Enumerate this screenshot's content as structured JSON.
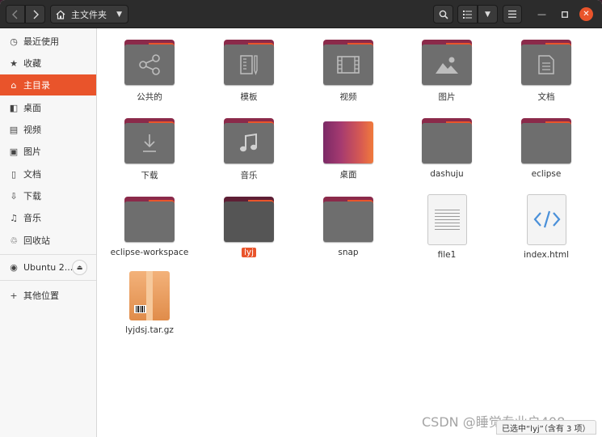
{
  "header": {
    "path_label": "主文件夹",
    "icons": {
      "back": "chevron-left-icon",
      "forward": "chevron-right-icon",
      "home": "home-icon",
      "search": "search-icon",
      "list": "list-view-icon",
      "menu": "hamburger-menu-icon"
    }
  },
  "sidebar": {
    "items": [
      {
        "label": "最近使用",
        "icon": "clock-icon"
      },
      {
        "label": "收藏",
        "icon": "star-icon"
      },
      {
        "label": "主目录",
        "icon": "home-icon",
        "active": true
      },
      {
        "label": "桌面",
        "icon": "desktop-icon"
      },
      {
        "label": "视频",
        "icon": "video-icon"
      },
      {
        "label": "图片",
        "icon": "image-icon"
      },
      {
        "label": "文档",
        "icon": "document-icon"
      },
      {
        "label": "下载",
        "icon": "download-icon"
      },
      {
        "label": "音乐",
        "icon": "music-icon"
      },
      {
        "label": "回收站",
        "icon": "trash-icon"
      }
    ],
    "device": {
      "label": "Ubuntu 2...",
      "icon": "disc-icon"
    },
    "other": {
      "label": "其他位置",
      "icon": "plus-icon"
    }
  },
  "files": [
    {
      "name": "公共的",
      "type": "folder",
      "glyph": "share-icon"
    },
    {
      "name": "模板",
      "type": "folder",
      "glyph": "template-icon"
    },
    {
      "name": "视频",
      "type": "folder",
      "glyph": "video-icon"
    },
    {
      "name": "图片",
      "type": "folder",
      "glyph": "image-icon"
    },
    {
      "name": "文档",
      "type": "folder",
      "glyph": "document-icon"
    },
    {
      "name": "下载",
      "type": "folder",
      "glyph": "download-icon"
    },
    {
      "name": "音乐",
      "type": "folder",
      "glyph": "music-icon"
    },
    {
      "name": "桌面",
      "type": "desktop"
    },
    {
      "name": "dashuju",
      "type": "folder"
    },
    {
      "name": "eclipse",
      "type": "folder"
    },
    {
      "name": "eclipse-workspace",
      "type": "folder"
    },
    {
      "name": "lyj",
      "type": "folder",
      "selected": true
    },
    {
      "name": "snap",
      "type": "folder"
    },
    {
      "name": "file1",
      "type": "text"
    },
    {
      "name": "index.html",
      "type": "html"
    },
    {
      "name": "lyjdsj.tar.gz",
      "type": "archive"
    }
  ],
  "status": "已选中“lyj”（含有 3 项）",
  "watermark": "CSDN @睡觉专业户408",
  "colors": {
    "accent": "#e9542b",
    "folder_tab": "#8b2a4a",
    "folder_body": "#6e6e6e"
  }
}
